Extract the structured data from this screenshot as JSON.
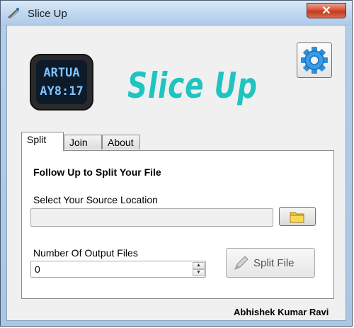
{
  "window": {
    "title": "Slice Up",
    "close_glyph": "✕"
  },
  "header": {
    "app_title": "Slice Up",
    "clock_line1": "ARTUA",
    "clock_line2": "AY8:17",
    "settings_icon": "gear-icon"
  },
  "tabs": [
    {
      "label": "Split",
      "active": true
    },
    {
      "label": "Join",
      "active": false
    },
    {
      "label": "About",
      "active": false
    }
  ],
  "split_tab": {
    "heading": "Follow Up to Split Your File",
    "source_label": "Select Your Source Location",
    "source_value": "",
    "browse_icon": "folder-icon",
    "count_label": "Number Of Output Files",
    "count_value": "0",
    "spin_up": "▲",
    "spin_down": "▼",
    "split_button": "Split File",
    "split_icon": "pencil-icon"
  },
  "footer": {
    "author": "Abhishek Kumar Ravi"
  },
  "colors": {
    "accent": "#1fc4c0",
    "frame": "#b3cde8",
    "close": "#c23a1f"
  }
}
